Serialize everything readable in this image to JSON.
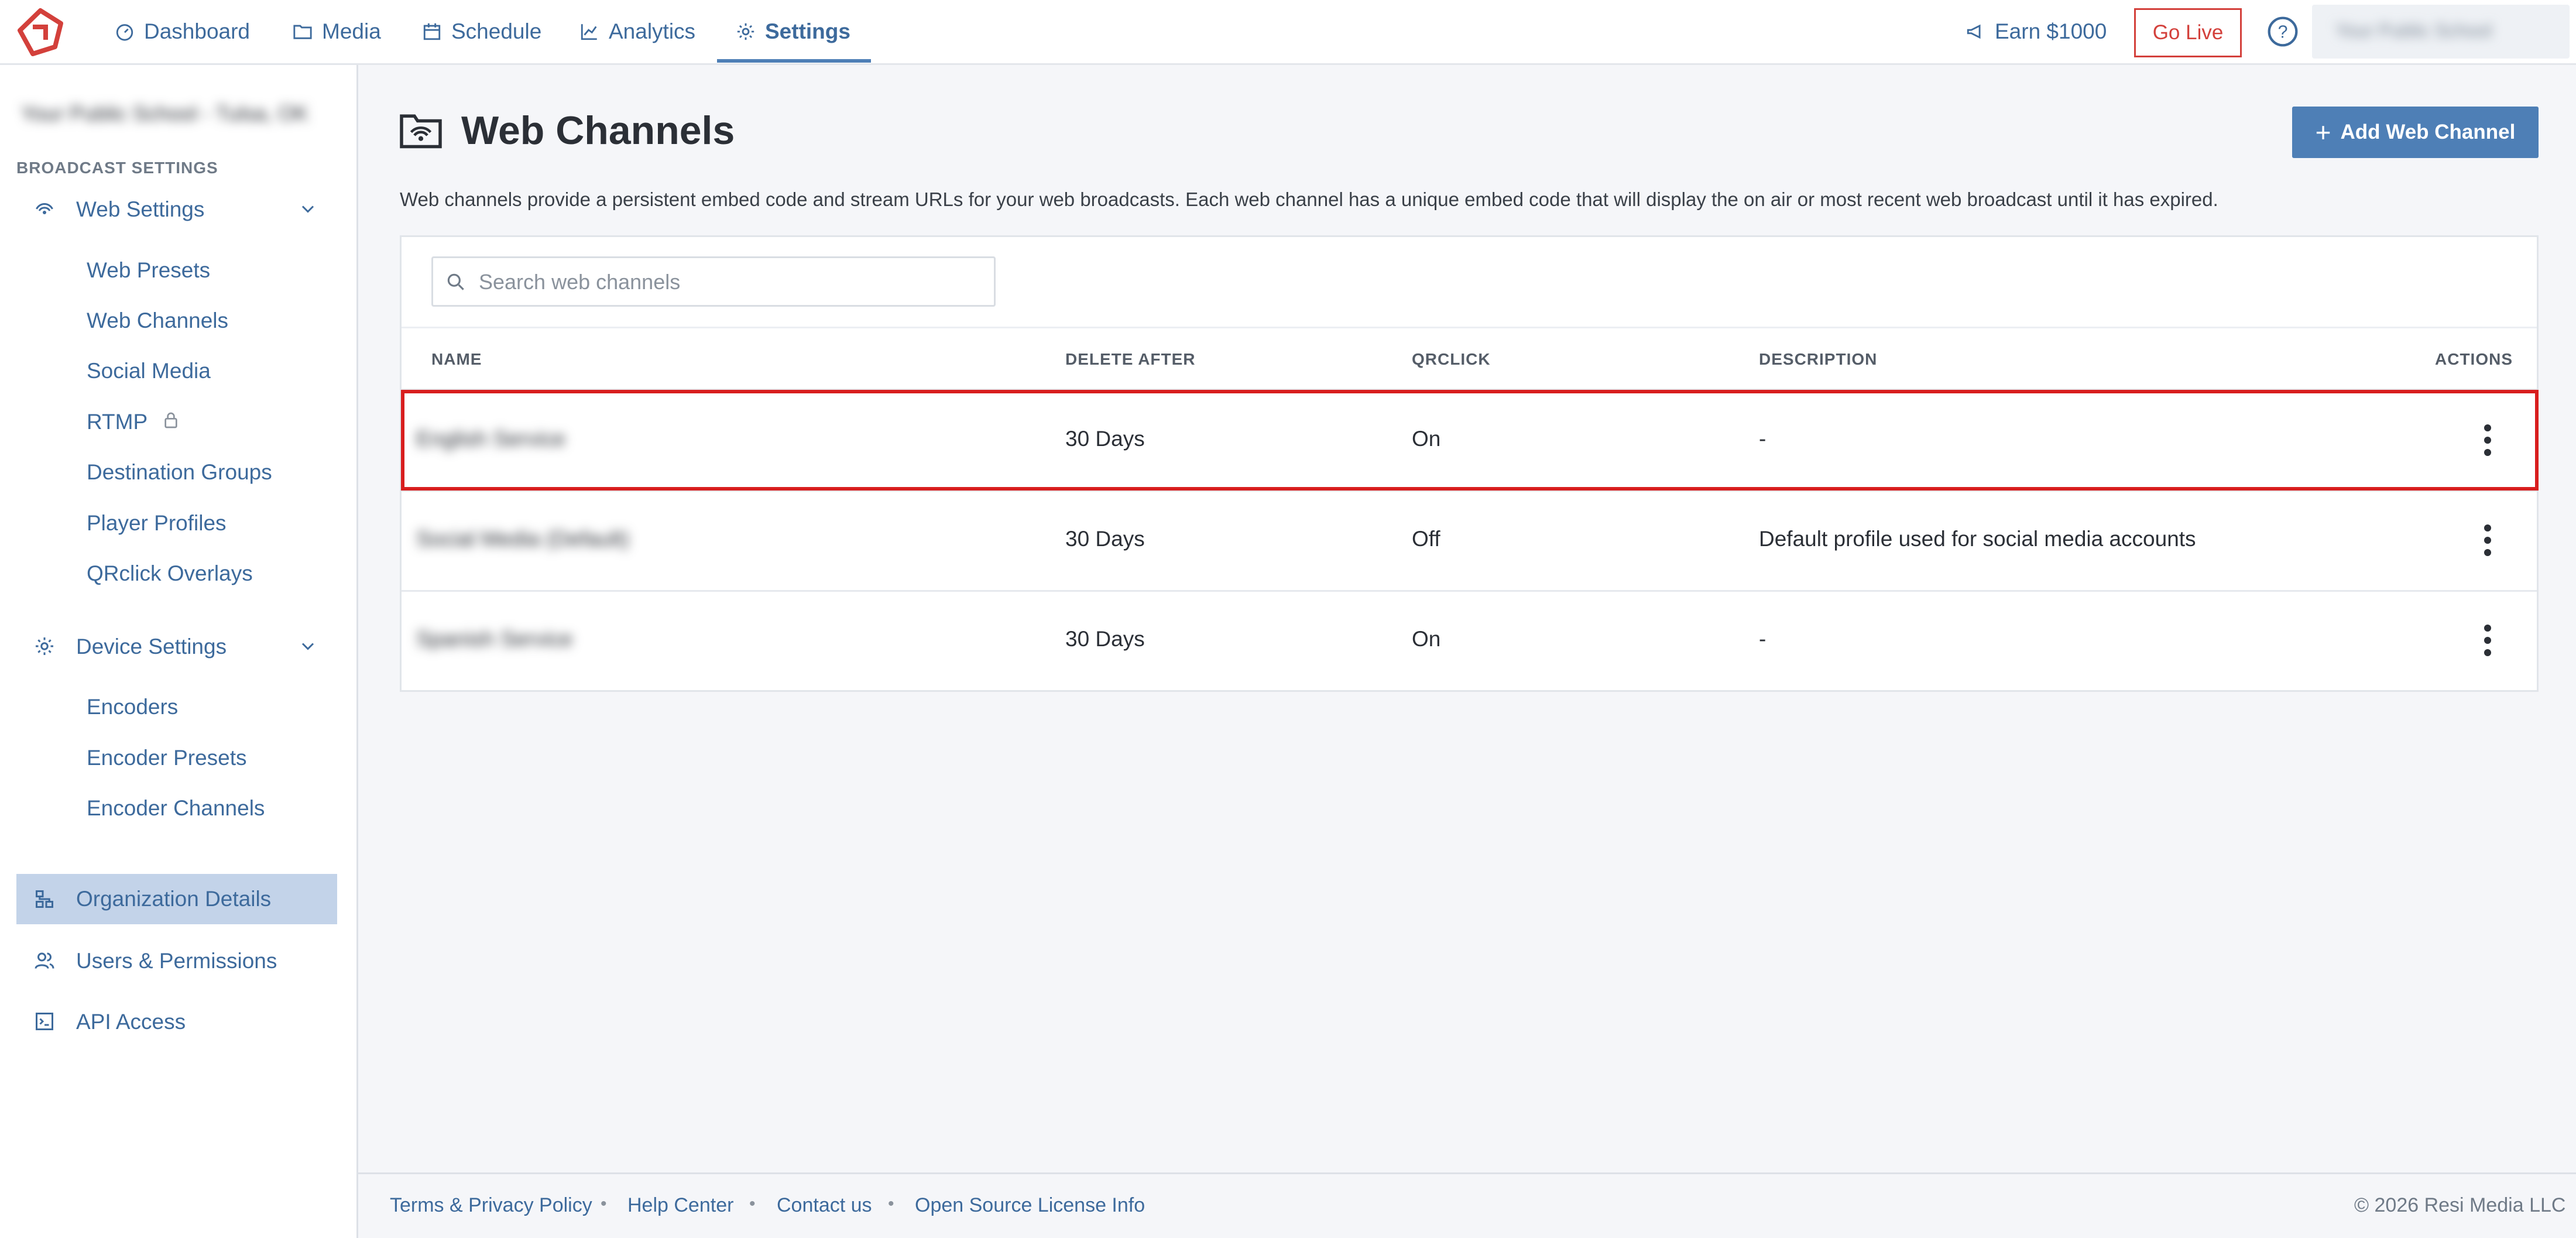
{
  "topnav": {
    "items": [
      {
        "label": "Dashboard",
        "icon": "dashboard-icon"
      },
      {
        "label": "Media",
        "icon": "folder-icon"
      },
      {
        "label": "Schedule",
        "icon": "calendar-icon"
      },
      {
        "label": "Analytics",
        "icon": "chart-line-icon"
      },
      {
        "label": "Settings",
        "icon": "gear-icon",
        "active": true
      }
    ],
    "earn_label": "Earn $1000",
    "go_live_label": "Go Live",
    "org_selector": "Your Public School"
  },
  "sidebar": {
    "org_name": "Your Public School - Tulsa, OK",
    "section_header": "BROADCAST SETTINGS",
    "web_settings": {
      "label": "Web Settings",
      "items": [
        "Web Presets",
        "Web Channels",
        "Social Media",
        "RTMP",
        "Destination Groups",
        "Player Profiles",
        "QRclick Overlays"
      ]
    },
    "device_settings": {
      "label": "Device Settings",
      "items": [
        "Encoders",
        "Encoder Presets",
        "Encoder Channels"
      ]
    },
    "organization_details": "Organization Details",
    "users_permissions": "Users & Permissions",
    "api_access": "API Access"
  },
  "main": {
    "title": "Web Channels",
    "description": "Web channels provide a persistent embed code and stream URLs for your web broadcasts. Each web channel has a unique embed code that will display the on air or most recent web broadcast until it has expired.",
    "add_button": "Add Web Channel",
    "search_placeholder": "Search web channels",
    "columns": [
      "NAME",
      "DELETE AFTER",
      "QRCLICK",
      "DESCRIPTION",
      "ACTIONS"
    ],
    "rows": [
      {
        "name": "English Service",
        "delete_after": "30 Days",
        "qrclick": "On",
        "description": "-"
      },
      {
        "name": "Social Media (Default)",
        "delete_after": "30 Days",
        "qrclick": "Off",
        "description": "Default profile used for social media accounts"
      },
      {
        "name": "Spanish Service",
        "delete_after": "30 Days",
        "qrclick": "On",
        "description": "-"
      }
    ]
  },
  "footer": {
    "links": [
      "Terms & Privacy Policy",
      "Help Center",
      "Contact us",
      "Open Source License Info"
    ],
    "copyright": "© 2026 Resi Media LLC"
  },
  "colors": {
    "accent": "#4e7fb6",
    "link": "#3d6a9c",
    "danger": "#d3403b",
    "highlight": "#d81e1e",
    "active_bg": "#c3d3e9"
  }
}
